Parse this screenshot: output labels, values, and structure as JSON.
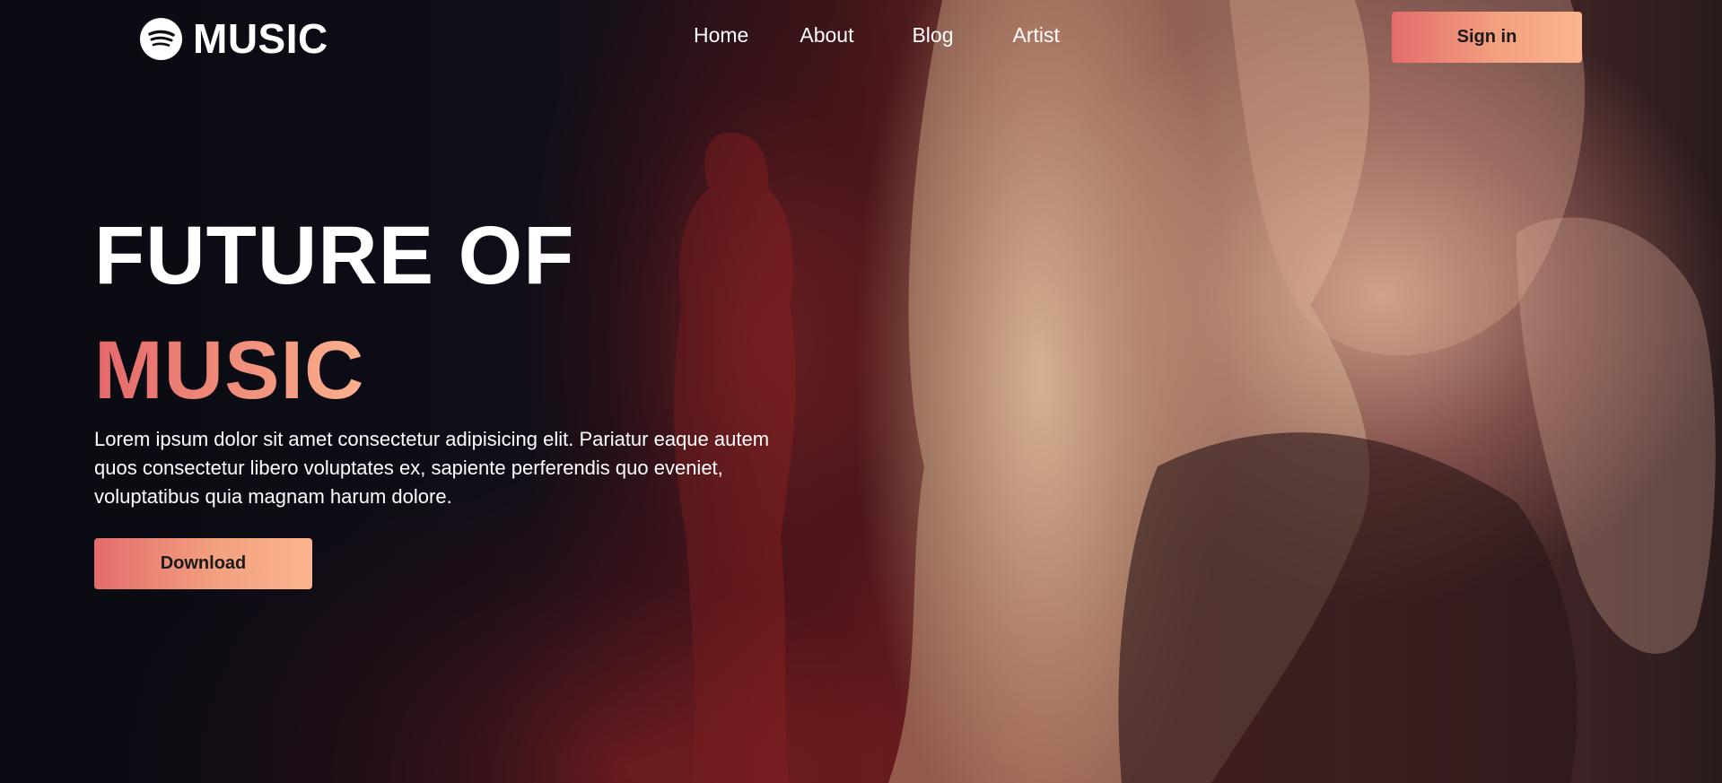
{
  "brand": {
    "name": "MUSIC",
    "icon": "spotify-logo-icon"
  },
  "nav": {
    "items": [
      {
        "label": "Home"
      },
      {
        "label": "About"
      },
      {
        "label": "Blog"
      },
      {
        "label": "Artist"
      }
    ],
    "signin_label": "Sign in"
  },
  "hero": {
    "title_line1": "FUTURE OF",
    "title_line2": "MUSIC",
    "description": "Lorem ipsum dolor sit amet consectetur adipisicing elit. Pariatur eaque autem quos consectetur libero voluptates ex, sapiente perferendis quo eveniet, voluptatibus quia magnam harum dolore.",
    "download_label": "Download"
  },
  "colors": {
    "accent_start": "#e46c6c",
    "accent_end": "#fbb48e",
    "background_dark": "#0e0d16"
  }
}
